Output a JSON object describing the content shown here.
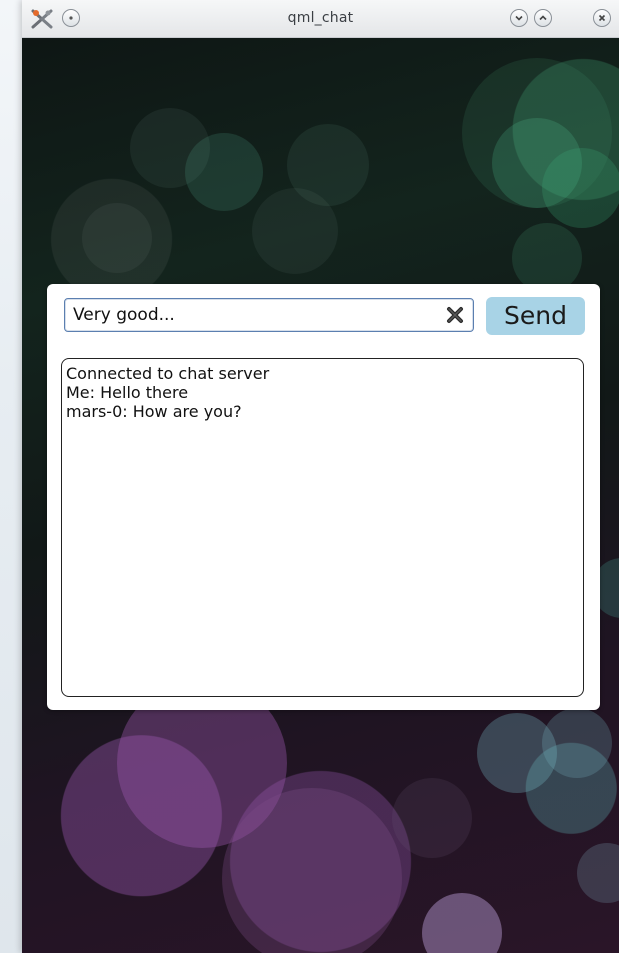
{
  "window": {
    "title": "qml_chat"
  },
  "compose": {
    "input_value": "Very good...",
    "send_label": "Send",
    "clear_icon": "clear-x-icon"
  },
  "chat": {
    "lines": [
      "Connected to chat server",
      "Me: Hello there",
      "mars-0: How are you?"
    ]
  },
  "colors": {
    "send_button": "#a8d3e6",
    "input_border": "#5b7fb0",
    "panel": "#ffffff"
  }
}
